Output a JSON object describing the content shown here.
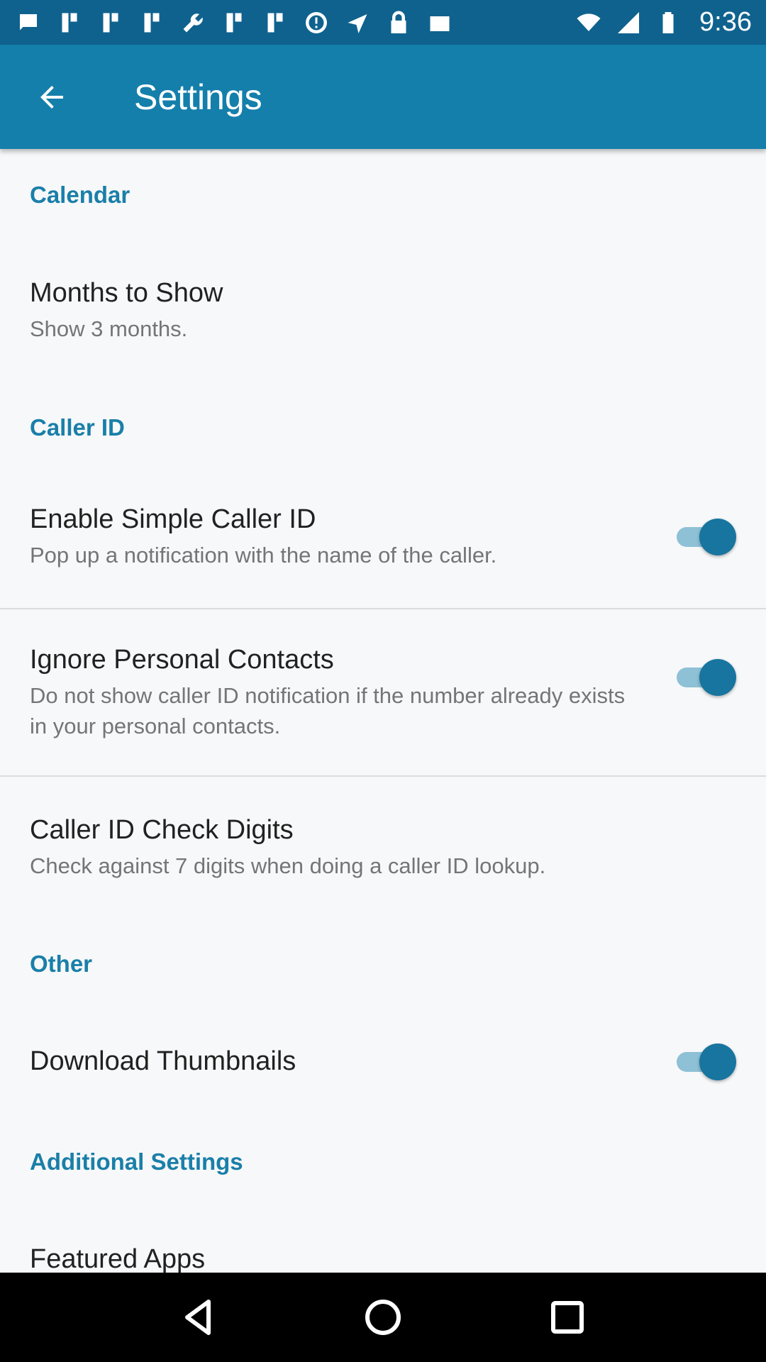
{
  "status_bar": {
    "time": "9:36",
    "icons": [
      "chat-icon",
      "bookmark-icon",
      "bookmark-icon",
      "bookmark-icon",
      "wrench-icon",
      "bookmark-icon",
      "bookmark-icon",
      "info-icon",
      "fake-gps-icon",
      "lock-icon",
      "photo-check-icon",
      "wifi-icon",
      "signal-icon",
      "battery-icon"
    ]
  },
  "app_bar": {
    "title": "Settings",
    "back_icon": "arrow-back-icon"
  },
  "sections": {
    "calendar": {
      "header": "Calendar",
      "months": {
        "title": "Months to Show",
        "summary": "Show 3 months."
      }
    },
    "caller_id": {
      "header": "Caller ID",
      "enable": {
        "title": "Enable Simple Caller ID",
        "summary": "Pop up a notification with the name of the caller.",
        "checked": true
      },
      "ignore": {
        "title": "Ignore Personal Contacts",
        "summary": "Do not show caller ID notification if the number already exists in your personal contacts.",
        "checked": true
      },
      "digits": {
        "title": "Caller ID Check Digits",
        "summary": "Check against 7 digits when doing a caller ID lookup."
      }
    },
    "other": {
      "header": "Other",
      "thumbnails": {
        "title": "Download Thumbnails",
        "checked": true
      }
    },
    "additional": {
      "header": "Additional Settings",
      "featured": {
        "title": "Featured Apps"
      }
    }
  },
  "nav_bar": {
    "back": "nav-back-icon",
    "home": "nav-home-icon",
    "recents": "nav-recents-icon"
  },
  "colors": {
    "status_bar": "#0f628e",
    "app_bar": "#157fab",
    "accent": "#1a7fa9",
    "toggle_thumb": "#17759f",
    "toggle_track": "#8ec0d6"
  }
}
